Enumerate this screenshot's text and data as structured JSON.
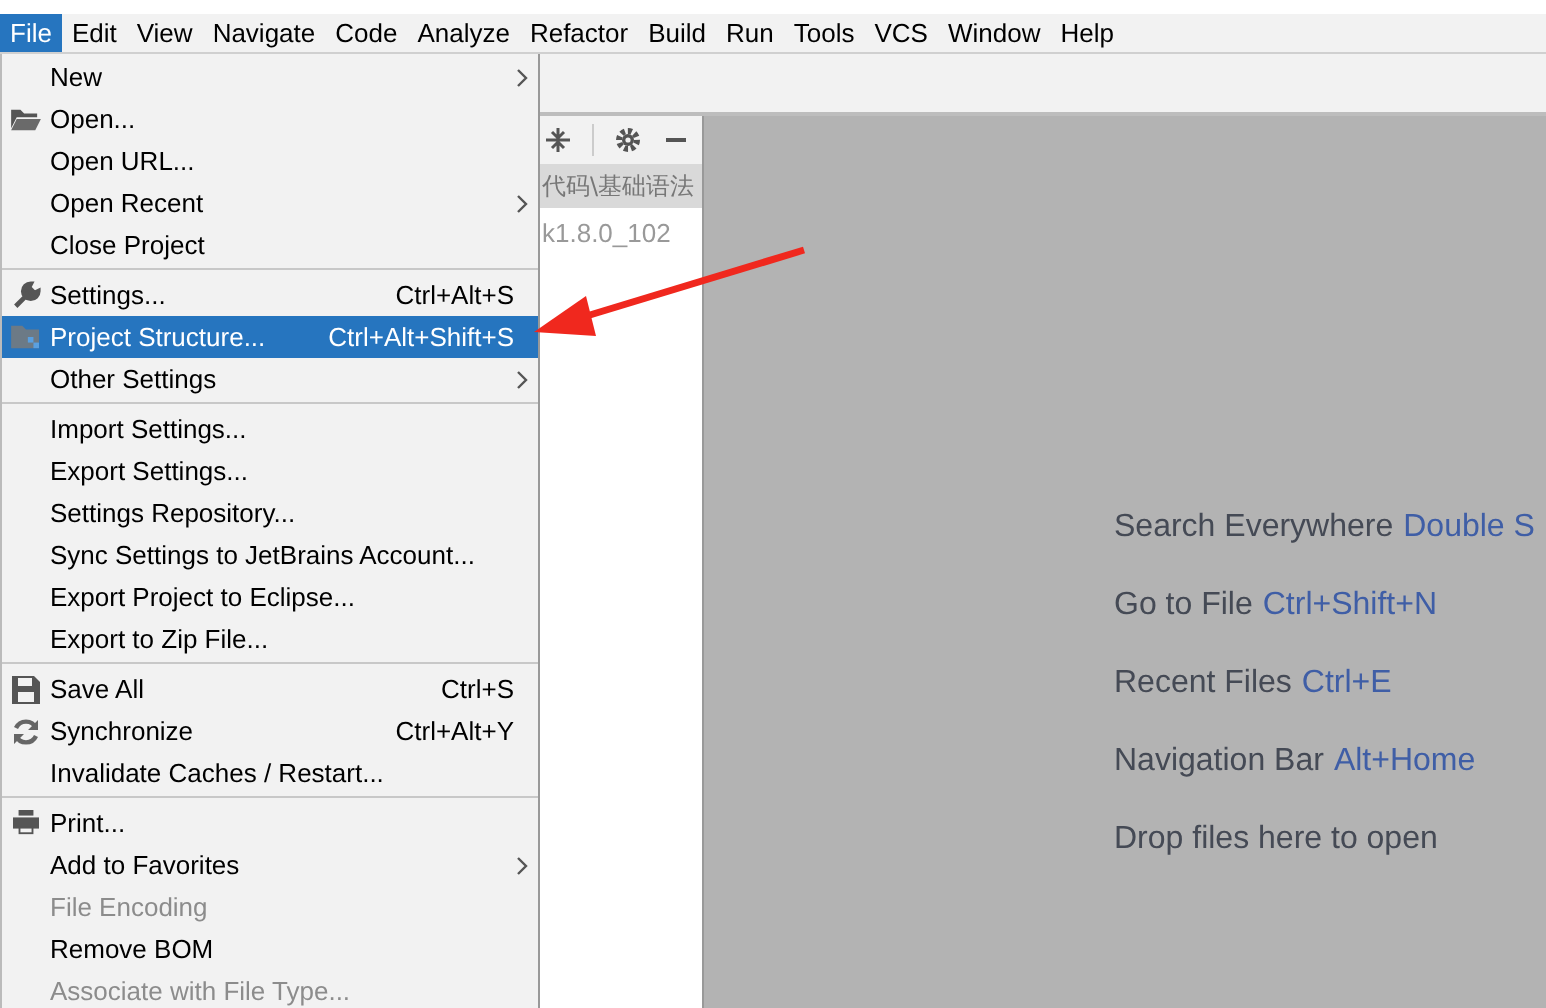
{
  "menu_bar": [
    {
      "label": "File",
      "selected": true
    },
    {
      "label": "Edit",
      "selected": false
    },
    {
      "label": "View",
      "selected": false
    },
    {
      "label": "Navigate",
      "selected": false
    },
    {
      "label": "Code",
      "selected": false
    },
    {
      "label": "Analyze",
      "selected": false
    },
    {
      "label": "Refactor",
      "selected": false
    },
    {
      "label": "Build",
      "selected": false
    },
    {
      "label": "Run",
      "selected": false
    },
    {
      "label": "Tools",
      "selected": false
    },
    {
      "label": "VCS",
      "selected": false
    },
    {
      "label": "Window",
      "selected": false
    },
    {
      "label": "Help",
      "selected": false
    }
  ],
  "project_panel": {
    "path": "代码\\基础语法",
    "sdk_text": "k1.8.0_102"
  },
  "file_menu": [
    {
      "kind": "item",
      "label": "New",
      "submenu": true,
      "disabled": false,
      "selected": false
    },
    {
      "kind": "item",
      "label": "Open...",
      "submenu": false,
      "disabled": false,
      "selected": false
    },
    {
      "kind": "item",
      "label": "Open URL...",
      "submenu": false,
      "disabled": false,
      "selected": false
    },
    {
      "kind": "item",
      "label": "Open Recent",
      "submenu": true,
      "disabled": false,
      "selected": false
    },
    {
      "kind": "item",
      "label": "Close Project",
      "submenu": false,
      "disabled": false,
      "selected": false
    },
    {
      "kind": "separator"
    },
    {
      "kind": "item",
      "label": "Settings...",
      "shortcut": "Ctrl+Alt+S",
      "submenu": false,
      "disabled": false,
      "selected": false
    },
    {
      "kind": "item",
      "label": "Project Structure...",
      "shortcut": "Ctrl+Alt+Shift+S",
      "submenu": false,
      "disabled": false,
      "selected": true
    },
    {
      "kind": "item",
      "label": "Other Settings",
      "submenu": true,
      "disabled": false,
      "selected": false
    },
    {
      "kind": "separator"
    },
    {
      "kind": "item",
      "label": "Import Settings...",
      "submenu": false,
      "disabled": false,
      "selected": false
    },
    {
      "kind": "item",
      "label": "Export Settings...",
      "submenu": false,
      "disabled": false,
      "selected": false
    },
    {
      "kind": "item",
      "label": "Settings Repository...",
      "submenu": false,
      "disabled": false,
      "selected": false
    },
    {
      "kind": "item",
      "label": "Sync Settings to JetBrains Account...",
      "submenu": false,
      "disabled": false,
      "selected": false
    },
    {
      "kind": "item",
      "label": "Export Project to Eclipse...",
      "submenu": false,
      "disabled": false,
      "selected": false
    },
    {
      "kind": "item",
      "label": "Export to Zip File...",
      "submenu": false,
      "disabled": false,
      "selected": false
    },
    {
      "kind": "separator"
    },
    {
      "kind": "item",
      "label": "Save All",
      "shortcut": "Ctrl+S",
      "submenu": false,
      "disabled": false,
      "selected": false
    },
    {
      "kind": "item",
      "label": "Synchronize",
      "shortcut": "Ctrl+Alt+Y",
      "submenu": false,
      "disabled": false,
      "selected": false
    },
    {
      "kind": "item",
      "label": "Invalidate Caches / Restart...",
      "submenu": false,
      "disabled": false,
      "selected": false
    },
    {
      "kind": "separator"
    },
    {
      "kind": "item",
      "label": "Print...",
      "submenu": false,
      "disabled": false,
      "selected": false
    },
    {
      "kind": "item",
      "label": "Add to Favorites",
      "submenu": true,
      "disabled": false,
      "selected": false
    },
    {
      "kind": "item",
      "label": "File Encoding",
      "submenu": false,
      "disabled": true,
      "selected": false
    },
    {
      "kind": "item",
      "label": "Remove BOM",
      "submenu": false,
      "disabled": false,
      "selected": false
    },
    {
      "kind": "item",
      "label": "Associate with File Type...",
      "submenu": false,
      "disabled": true,
      "selected": false
    }
  ],
  "welcome_hints": [
    {
      "label": "Search Everywhere",
      "shortcut": "Double S"
    },
    {
      "label": "Go to File",
      "shortcut": "Ctrl+Shift+N"
    },
    {
      "label": "Recent Files",
      "shortcut": "Ctrl+E"
    },
    {
      "label": "Navigation Bar",
      "shortcut": "Alt+Home"
    },
    {
      "label": "Drop files here to open"
    }
  ]
}
